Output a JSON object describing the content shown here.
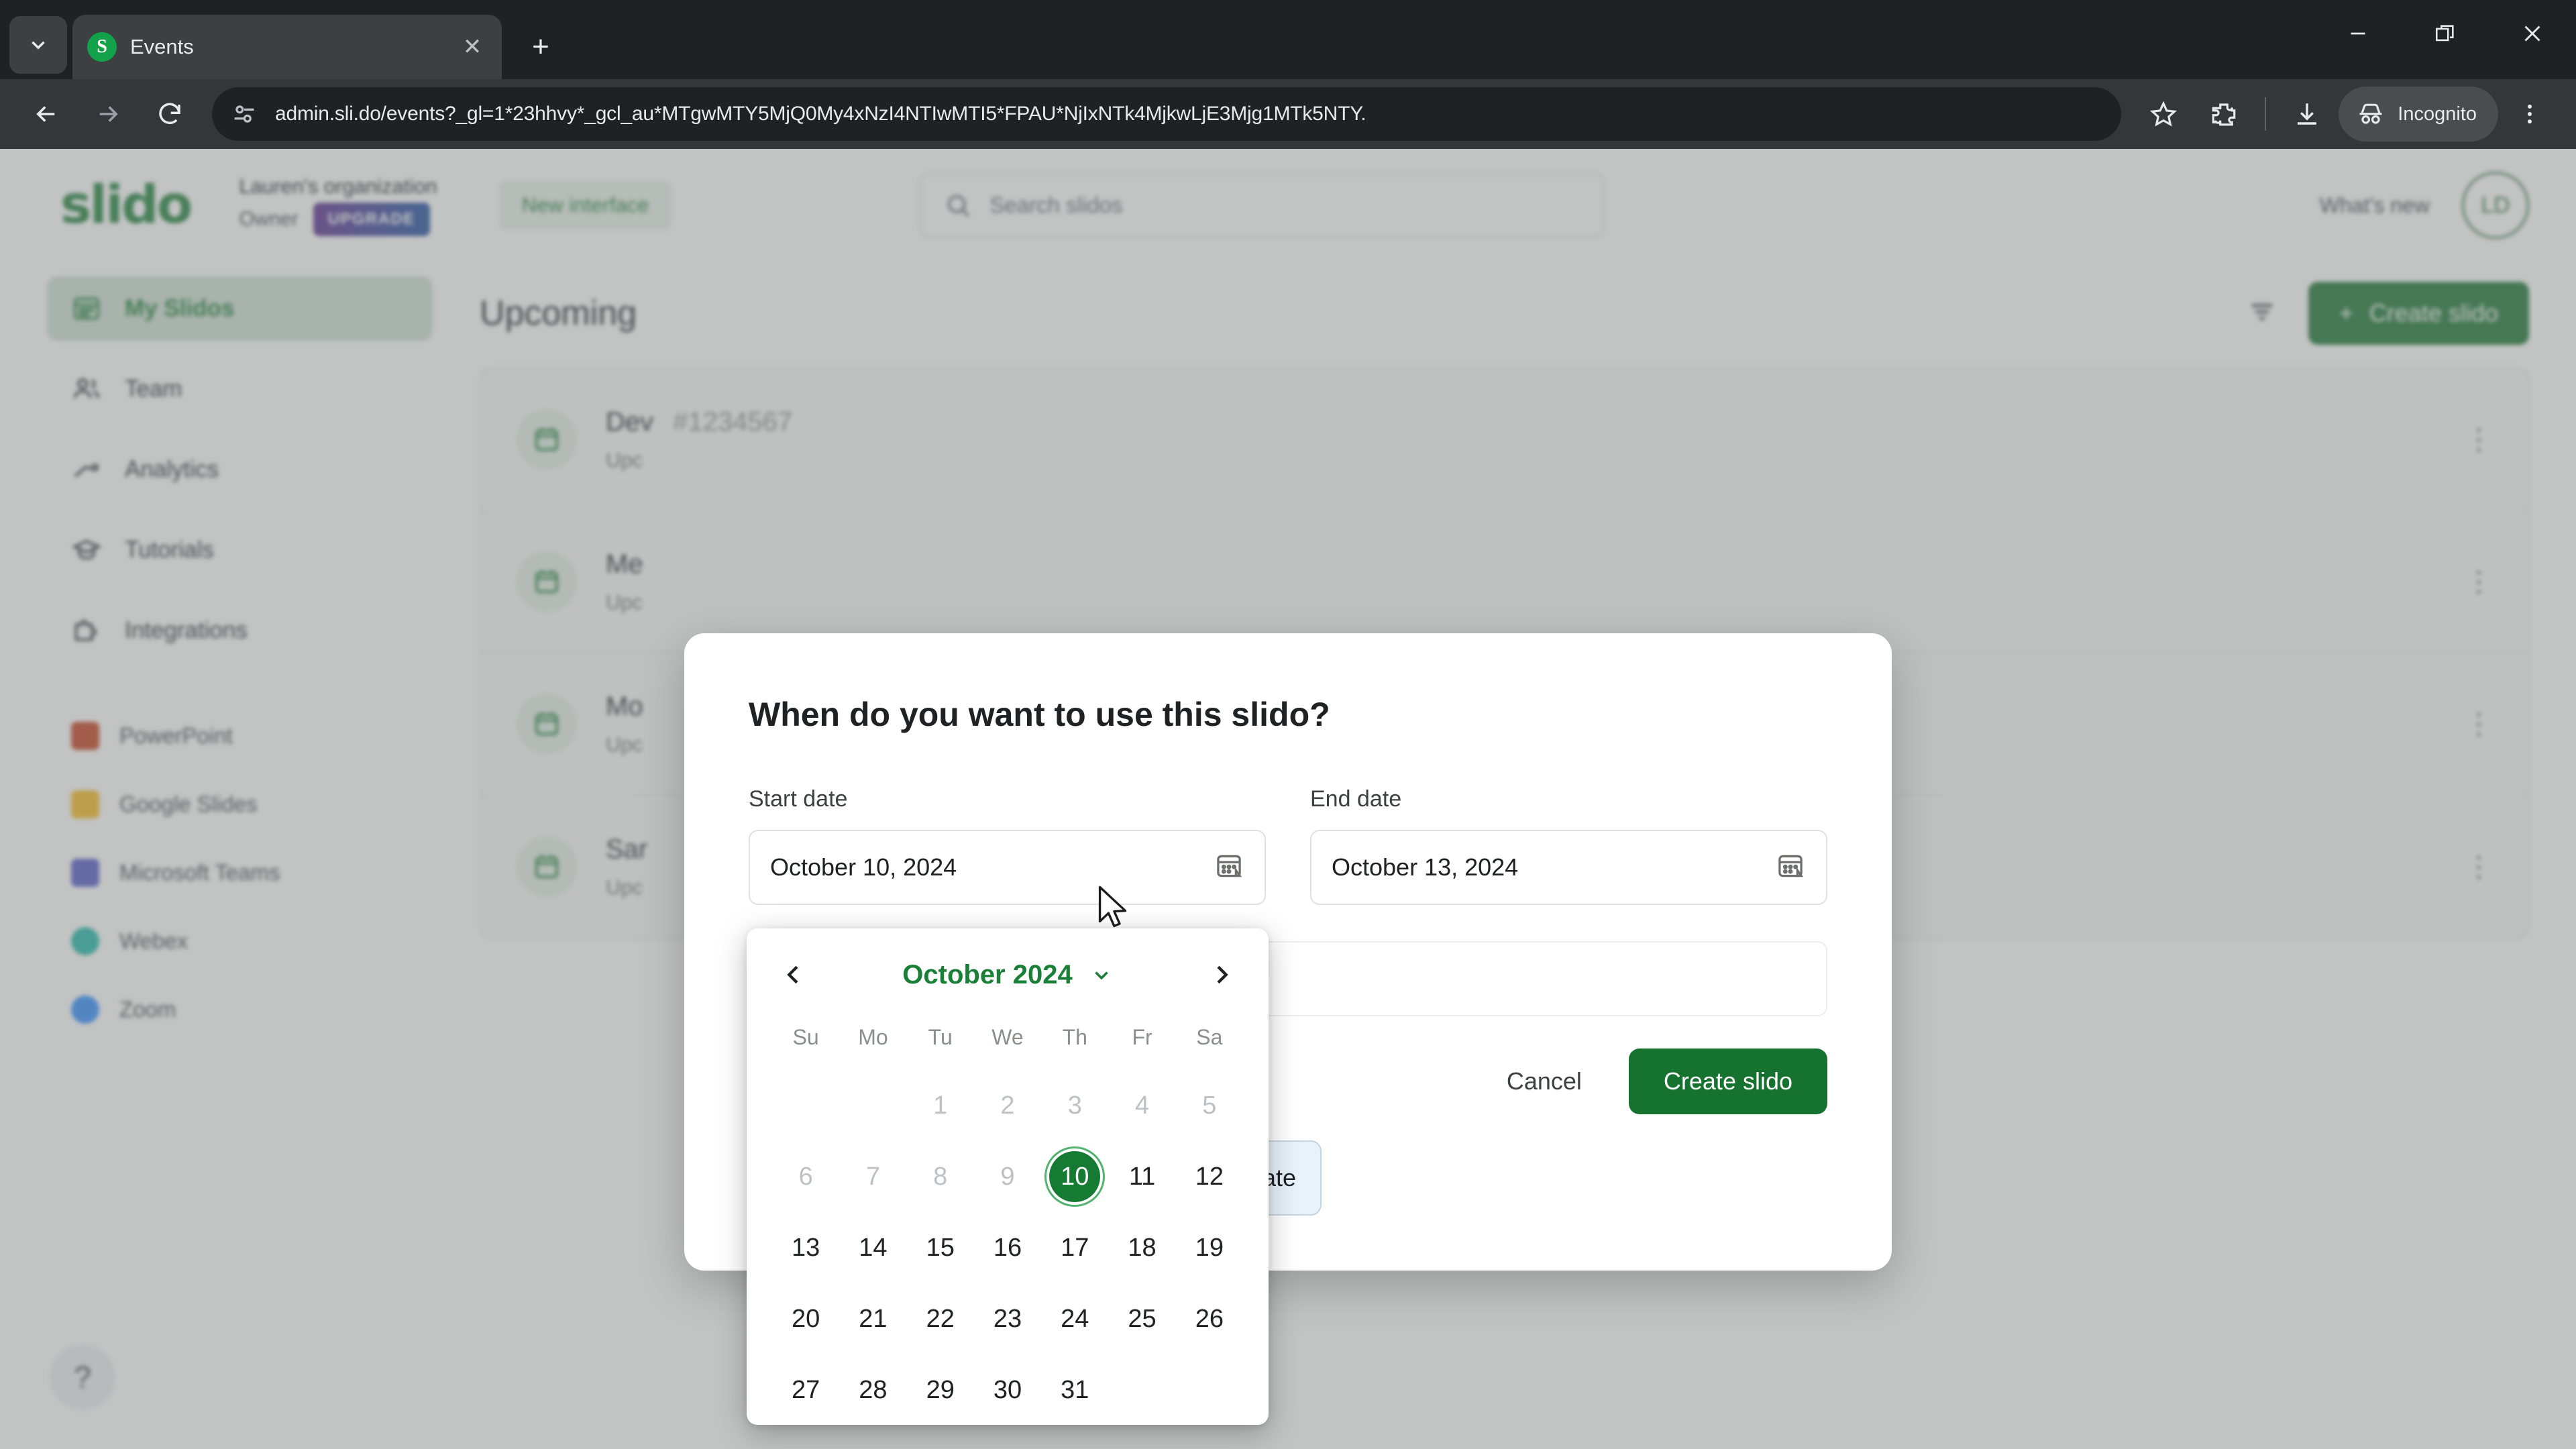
{
  "browser": {
    "tab": {
      "title": "Events",
      "favicon_letter": "S",
      "close_label": "✕"
    },
    "tablist_icon": "chevron-down-icon",
    "new_tab_label": "+",
    "window_controls": {
      "minimize": "—",
      "maximize": "❐",
      "close": "✕"
    },
    "nav": {
      "back": "←",
      "forward": "→",
      "reload": "↻"
    },
    "url": "admin.sli.do/events?_gl=1*23hhvy*_gcl_au*MTgwMTY5MjQ0My4xNzI4NTIwMTI5*FPAU*NjIxNTk4MjkwLjE3Mjg1MTk5NTY.",
    "actions": {
      "bookmark": "star-icon",
      "extensions": "puzzle-icon",
      "download": "download-icon",
      "menu": "kebab-menu-icon"
    },
    "profile_label": "Incognito"
  },
  "header": {
    "logo": "slido",
    "org_name": "Lauren's organization",
    "role": "Owner",
    "upgrade_label": "UPGRADE",
    "new_interface_label": "New interface",
    "search_placeholder": "Search slidos",
    "whats_new_label": "What's new",
    "avatar_initials": "LD"
  },
  "sidebar": {
    "primary": [
      {
        "label": "My Slidos",
        "icon": "grid-icon",
        "active": true
      },
      {
        "label": "Team",
        "icon": "people-icon",
        "active": false
      },
      {
        "label": "Analytics",
        "icon": "trend-up-icon",
        "active": false
      },
      {
        "label": "Tutorials",
        "icon": "graduation-cap-icon",
        "active": false
      },
      {
        "label": "Integrations",
        "icon": "puzzle-piece-icon",
        "active": false
      }
    ],
    "integrations": [
      {
        "label": "PowerPoint",
        "icon": "powerpoint-icon",
        "color": "#C43E1C"
      },
      {
        "label": "Google Slides",
        "icon": "google-slides-icon",
        "color": "#F5BB1D"
      },
      {
        "label": "Microsoft Teams",
        "icon": "microsoft-teams-icon",
        "color": "#5059C9"
      },
      {
        "label": "Webex",
        "icon": "webex-icon",
        "color": "#1BB7A8"
      },
      {
        "label": "Zoom",
        "icon": "zoom-icon",
        "color": "#2D8CFF"
      }
    ],
    "help_label": "?"
  },
  "main": {
    "section_title": "Upcoming",
    "filter_icon": "filter-icon",
    "create_slido_label": "Create slido",
    "create_slido_plus": "+",
    "rows": [
      {
        "title": "Dev",
        "code": "#1234567",
        "subtitle": "Upc"
      },
      {
        "title": "Me",
        "code": "",
        "subtitle": "Upc"
      },
      {
        "title": "Mo",
        "code": "",
        "subtitle": "Upc"
      },
      {
        "title": "Sar",
        "code": "",
        "subtitle": "Upc"
      }
    ],
    "row_menu_icon": "kebab-menu-icon"
  },
  "modal": {
    "title": "When do you want to use this slido?",
    "start_label": "Start date",
    "start_value": "October 10, 2024",
    "end_label": "End date",
    "end_value": "October 13, 2024",
    "calendar_icon": "calendar-icon",
    "extra_input_value": "",
    "participate_label": "cipate",
    "cancel_label": "Cancel",
    "submit_label": "Create slido"
  },
  "calendar": {
    "prev_icon": "chevron-left-icon",
    "next_icon": "chevron-right-icon",
    "month_label": "October 2024",
    "month_dropdown_icon": "chevron-down-icon",
    "weekdays": [
      "Su",
      "Mo",
      "Tu",
      "We",
      "Th",
      "Fr",
      "Sa"
    ],
    "leading_blanks": 2,
    "days": [
      {
        "n": 1,
        "state": "muted"
      },
      {
        "n": 2,
        "state": "muted"
      },
      {
        "n": 3,
        "state": "muted"
      },
      {
        "n": 4,
        "state": "muted"
      },
      {
        "n": 5,
        "state": "muted"
      },
      {
        "n": 6,
        "state": "muted"
      },
      {
        "n": 7,
        "state": "muted"
      },
      {
        "n": 8,
        "state": "muted"
      },
      {
        "n": 9,
        "state": "muted"
      },
      {
        "n": 10,
        "state": "selected"
      },
      {
        "n": 11,
        "state": "normal"
      },
      {
        "n": 12,
        "state": "normal"
      },
      {
        "n": 13,
        "state": "normal"
      },
      {
        "n": 14,
        "state": "normal"
      },
      {
        "n": 15,
        "state": "normal"
      },
      {
        "n": 16,
        "state": "normal"
      },
      {
        "n": 17,
        "state": "normal"
      },
      {
        "n": 18,
        "state": "normal"
      },
      {
        "n": 19,
        "state": "normal"
      },
      {
        "n": 20,
        "state": "normal"
      },
      {
        "n": 21,
        "state": "normal"
      },
      {
        "n": 22,
        "state": "normal"
      },
      {
        "n": 23,
        "state": "normal"
      },
      {
        "n": 24,
        "state": "normal"
      },
      {
        "n": 25,
        "state": "normal"
      },
      {
        "n": 26,
        "state": "normal"
      },
      {
        "n": 27,
        "state": "normal"
      },
      {
        "n": 28,
        "state": "normal"
      },
      {
        "n": 29,
        "state": "normal"
      },
      {
        "n": 30,
        "state": "normal"
      },
      {
        "n": 31,
        "state": "normal"
      }
    ]
  },
  "colors": {
    "brand_green": "#1a7f37",
    "button_green": "#15722f",
    "selected_day": "#157a32",
    "chrome_dark": "#202124",
    "toolbar_dark": "#35363a"
  }
}
